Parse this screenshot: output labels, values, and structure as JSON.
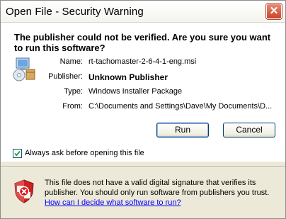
{
  "window": {
    "title": "Open File - Security Warning"
  },
  "headline": "The publisher could not be verified.  Are you sure you want to run this software?",
  "details": [
    {
      "label": "Name:",
      "value": "rt-tachomaster-2-6-4-1-eng.msi",
      "bold": false
    },
    {
      "label": "Publisher:",
      "value": "Unknown Publisher",
      "bold": true
    },
    {
      "label": "Type:",
      "value": "Windows Installer Package",
      "bold": false
    },
    {
      "label": "From:",
      "value": "C:\\Documents and Settings\\Dave\\My Documents\\D...",
      "bold": false
    }
  ],
  "buttons": {
    "run": "Run",
    "cancel": "Cancel"
  },
  "checkbox": {
    "label": "Always ask before opening this file",
    "checked": true
  },
  "warning": {
    "text": "This file does not have a valid digital signature that verifies its publisher.  You should only run software from publishers you trust.",
    "link": "How can I decide what software to run?"
  },
  "icons": {
    "close": "close-icon",
    "package": "installer-package-icon",
    "shield": "security-shield-icon"
  }
}
